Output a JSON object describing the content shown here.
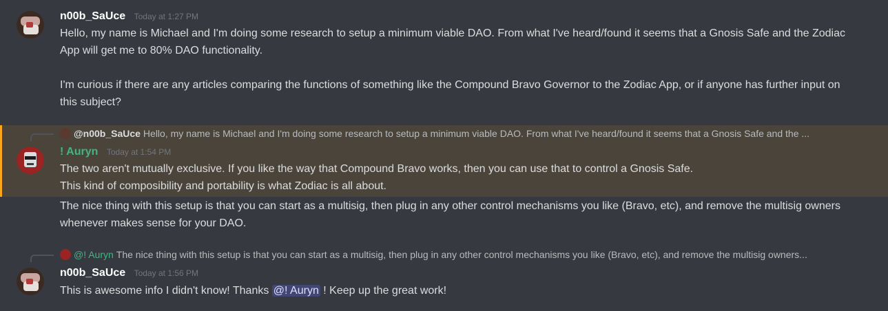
{
  "messages": [
    {
      "author": "n00b_SaUce",
      "timestamp": "Today at 1:27 PM",
      "avatar": "n00b-sauce-avatar",
      "lines": [
        "Hello, my name is Michael and I'm doing some research to setup a minimum viable DAO. From what I've heard/found it seems that a Gnosis Safe and the Zodiac App will get me to 80% DAO functionality.",
        "I'm curious if there are any articles comparing the functions of something like the Compound Bravo Governor to the Zodiac App, or if anyone has further input on this subject?"
      ]
    },
    {
      "reply_to": {
        "mention": "@n00b_SaUce",
        "preview": "Hello, my name is Michael and I'm doing some research to setup a minimum viable DAO. From what I've heard/found it seems that a Gnosis Safe and the ..."
      },
      "author": "! Auryn",
      "timestamp": "Today at 1:54 PM",
      "avatar": "auryn-avatar",
      "highlighted": true,
      "lines": [
        "The two aren't mutually exclusive. If you like the way that Compound Bravo works, then you can use that to control a Gnosis Safe.",
        "This kind of composibility and portability is what Zodiac is all about."
      ],
      "followup": "The nice thing with this setup is that you can start as a multisig, then plug in any other control mechanisms you like (Bravo, etc), and remove the multisig owners whenever makes sense for your DAO."
    },
    {
      "reply_to": {
        "mention": "@! Auryn",
        "preview": "The nice thing with this setup is that you can start as a multisig, then plug in any other control mechanisms you like (Bravo, etc), and remove the multisig owners..."
      },
      "author": "n00b_SaUce",
      "timestamp": "Today at 1:56 PM",
      "avatar": "n00b-sauce-avatar",
      "text_before": "This is awesome info I didn't know! Thanks ",
      "mention": "@! Auryn",
      "text_after": " ! Keep up the great work!"
    }
  ],
  "colors": {
    "background": "#36393f",
    "highlight": "#4a443b",
    "highlight_border": "#faa61a",
    "auryn_name": "#43b581",
    "mention_bg": "#414675"
  }
}
